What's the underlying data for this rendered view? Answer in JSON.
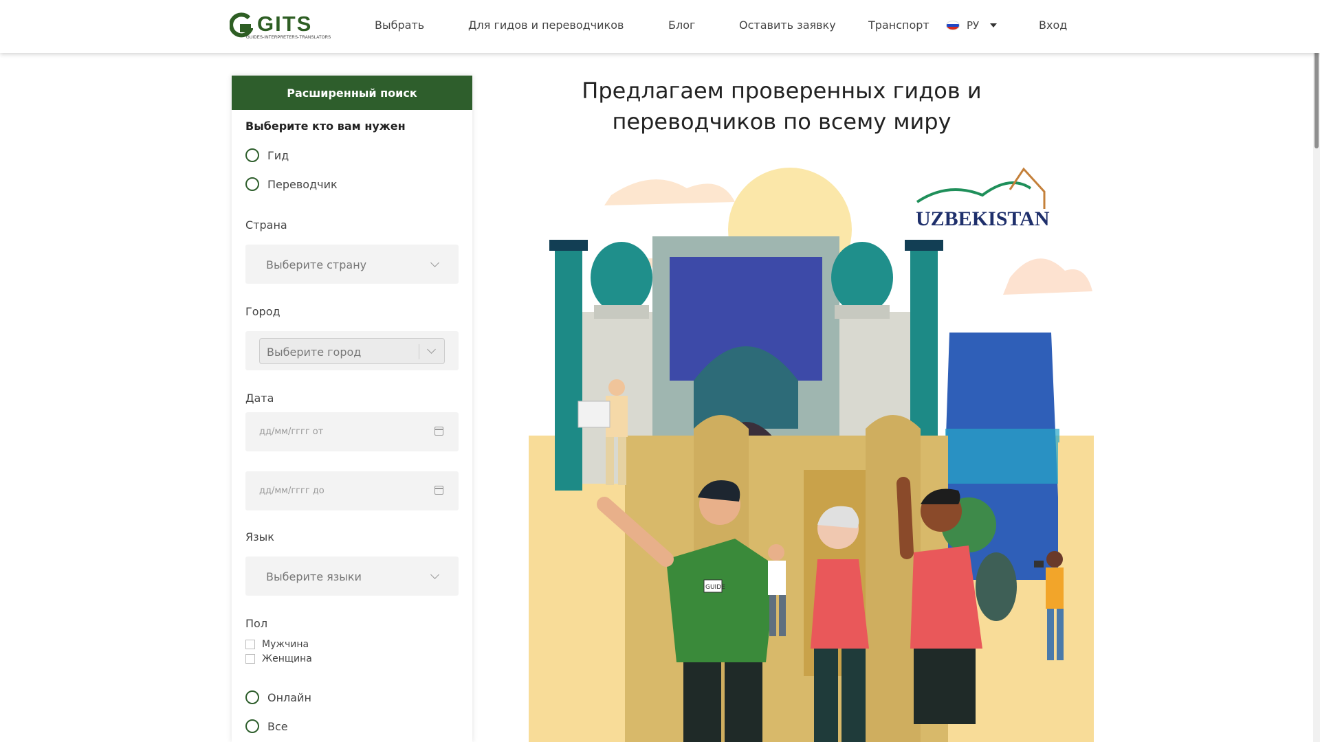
{
  "header": {
    "logo_text": "GITS",
    "logo_tagline": "GUIDES-INTERPRETERS-TRANSLATORS",
    "nav": [
      "Выбрать",
      "Для гидов и переводчиков",
      "Блог",
      "Оставить заявку",
      "Транспорт"
    ],
    "lang": "РУ",
    "login": "Вход"
  },
  "sidebar": {
    "title": "Расширенный поиск",
    "who_label": "Выберите кто вам нужен",
    "who_options": [
      "Гид",
      "Переводчик"
    ],
    "country_label": "Страна",
    "country_placeholder": "Выберите страну",
    "city_label": "Город",
    "city_placeholder": "Выберите город",
    "date_label": "Дата",
    "date_from": "дд/мм/гггг от",
    "date_to": "дд/мм/гггг до",
    "language_label": "Язык",
    "language_placeholder": "Выберите языки",
    "gender_label": "Пол",
    "gender_options": [
      "Мужчина",
      "Женщина"
    ],
    "mode_options": [
      "Онлайн",
      "Все"
    ]
  },
  "main": {
    "title_line1": "Предлагаем проверенных гидов и",
    "title_line2": "переводчиков по всему миру",
    "badge_text": "UZBEKISTAN",
    "guide_badge": "GUIDE"
  },
  "colors": {
    "brand_green": "#2e5e2c",
    "teal": "#1d8a86",
    "sand": "#f8dc98"
  }
}
